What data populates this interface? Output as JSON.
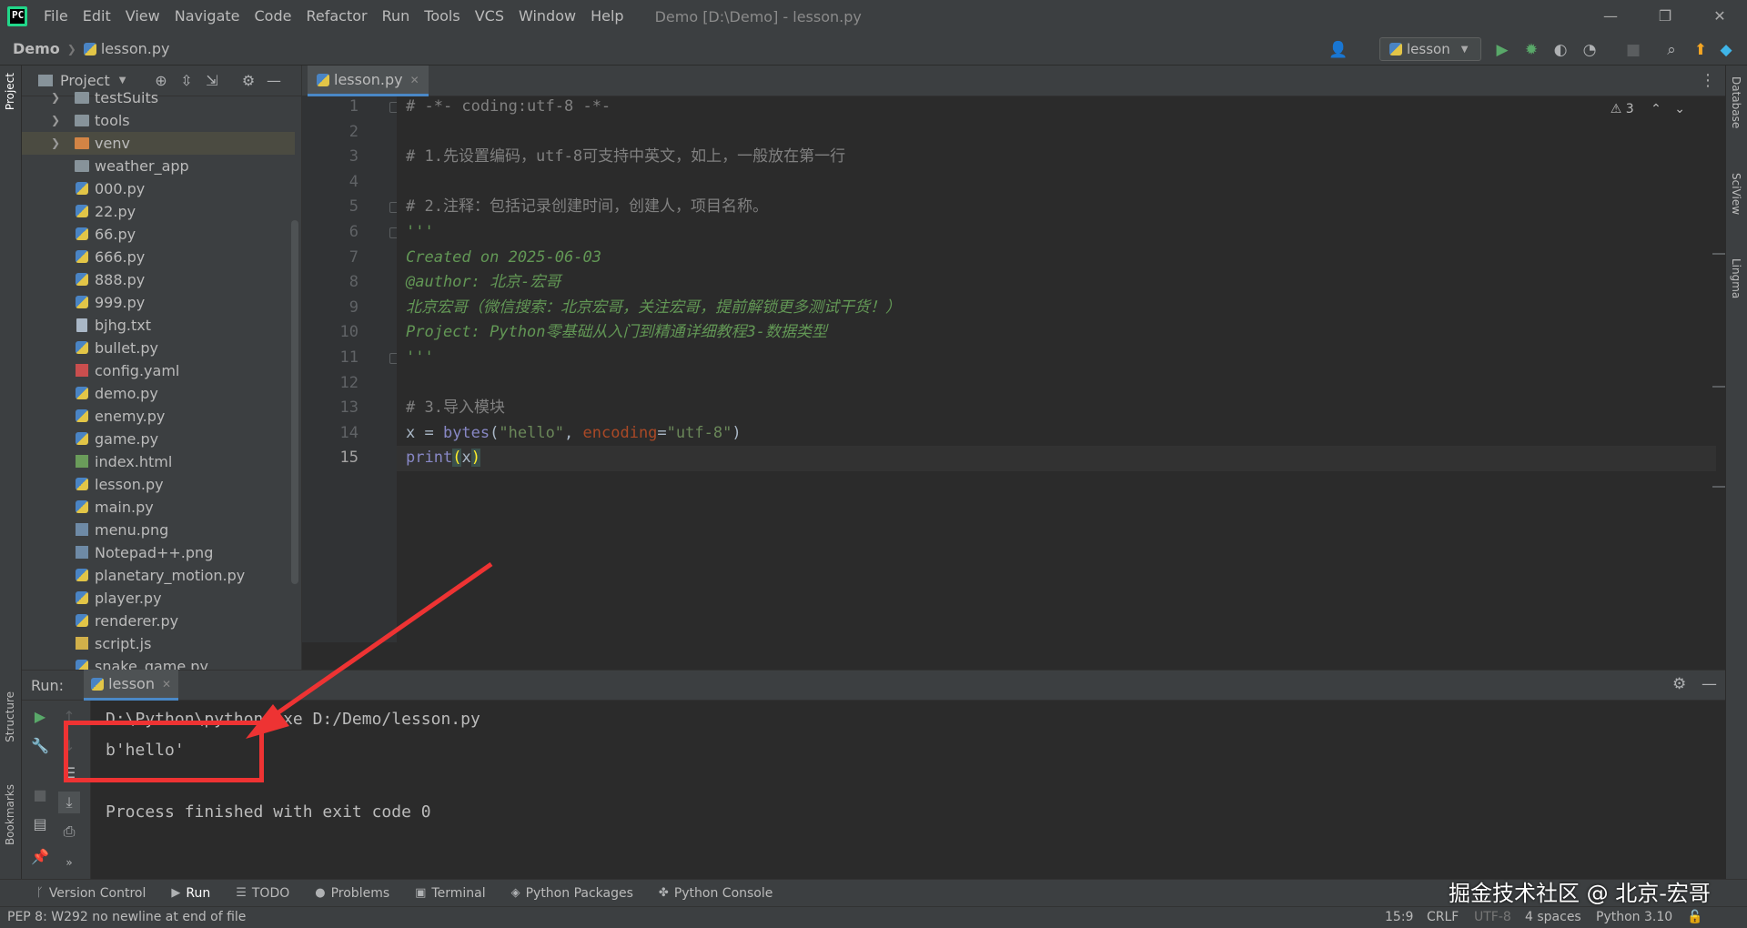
{
  "menubar": {
    "items": [
      "File",
      "Edit",
      "View",
      "Navigate",
      "Code",
      "Refactor",
      "Run",
      "Tools",
      "VCS",
      "Window",
      "Help"
    ],
    "window_title": "Demo [D:\\Demo] - lesson.py",
    "logo_text": "PC"
  },
  "navbar": {
    "project": "Demo",
    "file": "lesson.py",
    "run_config": "lesson"
  },
  "left_stripe": {
    "project": "Project",
    "structure": "Structure",
    "bookmarks": "Bookmarks"
  },
  "right_stripe": {
    "database": "Database",
    "sciview": "SciView",
    "lingma": "Lingma"
  },
  "project_panel": {
    "title": "Project",
    "items": [
      {
        "label": "testSuits",
        "kind": "folder",
        "expandable": true
      },
      {
        "label": "tools",
        "kind": "folder",
        "expandable": true
      },
      {
        "label": "venv",
        "kind": "folder-orange",
        "expandable": true,
        "selected": true
      },
      {
        "label": "weather_app",
        "kind": "folder",
        "expandable": false
      },
      {
        "label": "000.py",
        "kind": "py"
      },
      {
        "label": "22.py",
        "kind": "py"
      },
      {
        "label": "66.py",
        "kind": "py"
      },
      {
        "label": "666.py",
        "kind": "py"
      },
      {
        "label": "888.py",
        "kind": "py"
      },
      {
        "label": "999.py",
        "kind": "py"
      },
      {
        "label": "bjhg.txt",
        "kind": "txt"
      },
      {
        "label": "bullet.py",
        "kind": "py"
      },
      {
        "label": "config.yaml",
        "kind": "yaml"
      },
      {
        "label": "demo.py",
        "kind": "py"
      },
      {
        "label": "enemy.py",
        "kind": "py"
      },
      {
        "label": "game.py",
        "kind": "py"
      },
      {
        "label": "index.html",
        "kind": "html"
      },
      {
        "label": "lesson.py",
        "kind": "py"
      },
      {
        "label": "main.py",
        "kind": "py"
      },
      {
        "label": "menu.png",
        "kind": "png"
      },
      {
        "label": "Notepad++.png",
        "kind": "png"
      },
      {
        "label": "planetary_motion.py",
        "kind": "py"
      },
      {
        "label": "player.py",
        "kind": "py"
      },
      {
        "label": "renderer.py",
        "kind": "py"
      },
      {
        "label": "script.js",
        "kind": "js"
      },
      {
        "label": "snake_game.py",
        "kind": "py"
      }
    ]
  },
  "editor": {
    "tab": "lesson.py",
    "inspections": "3",
    "lines": [
      "# -*- coding:utf-8 -*-",
      "",
      "# 1.先设置编码，utf-8可支持中英文，如上，一般放在第一行",
      "",
      "# 2.注释：包括记录创建时间，创建人，项目名称。",
      "'''",
      "Created on 2025-06-03",
      "@author: 北京-宏哥",
      "北京宏哥（微信搜索：北京宏哥，关注宏哥，提前解锁更多测试干货！）",
      "Project: Python零基础从入门到精通详细教程3-数据类型",
      "'''",
      "",
      "# 3.导入模块",
      "x = bytes(\"hello\", encoding=\"utf-8\")",
      "print(x)"
    ],
    "code14": {
      "a": "x = ",
      "b": "bytes",
      "c": "(",
      "d": "\"hello\"",
      "e": ", ",
      "f": "encoding",
      "g": "=",
      "h": "\"utf-8\"",
      "i": ")"
    },
    "code15": {
      "a": "print",
      "b": "(",
      "c": "x",
      "d": ")"
    },
    "current_line": 15
  },
  "run_panel": {
    "title": "Run:",
    "tab": "lesson",
    "console": [
      "D:\\Python\\python.exe D:/Demo/lesson.py",
      "b'hello'",
      "",
      "Process finished with exit code 0"
    ]
  },
  "bottom_tools": {
    "items": [
      "Version Control",
      "Run",
      "TODO",
      "Problems",
      "Terminal",
      "Python Packages",
      "Python Console"
    ]
  },
  "statusbar": {
    "message": "PEP 8: W292 no newline at end of file",
    "position": "15:9",
    "line_sep": "CRLF",
    "encoding": "UTF-8",
    "indent": "4 spaces",
    "interpreter": "Python 3.10"
  },
  "watermark": "掘金技术社区 @ 北京-宏哥",
  "colors": {
    "background": "#2b2b2b",
    "panel": "#3c3f41",
    "accent": "#4a88c7",
    "annotation": "#ee3333"
  }
}
